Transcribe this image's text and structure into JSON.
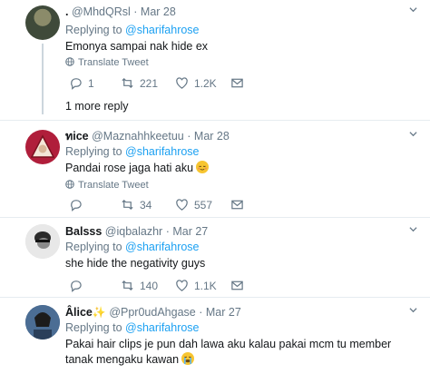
{
  "tweets": [
    {
      "display_name": ".",
      "handle": "@MhdQRsl",
      "time": "Mar 28",
      "reply_prefix": "Replying to",
      "reply_mention": "@sharifahrose",
      "text": "Emonya sampai nak hide ex",
      "translate": "Translate Tweet",
      "replies": "1",
      "retweets": "221",
      "likes": "1.2K",
      "more_replies": "1 more reply"
    },
    {
      "display_name": "ทice",
      "handle": "@Maznahhkeetuu",
      "time": "Mar 28",
      "reply_prefix": "Replying to",
      "reply_mention": "@sharifahrose",
      "text": "Pandai rose jaga hati aku",
      "emoji": "relieved-face",
      "translate": "Translate Tweet",
      "replies": "",
      "retweets": "34",
      "likes": "557"
    },
    {
      "display_name": "Balsss",
      "handle": "@iqbalazhr",
      "time": "Mar 27",
      "reply_prefix": "Replying to",
      "reply_mention": "@sharifahrose",
      "text": "she hide the negativity guys",
      "replies": "",
      "retweets": "140",
      "likes": "1.1K"
    },
    {
      "display_name": "Âlice",
      "name_emoji": "sparkles",
      "handle": "@Ppr0udAhgase",
      "time": "Mar 27",
      "reply_prefix": "Replying to",
      "reply_mention": "@sharifahrose",
      "text": "Pakai hair clips je pun dah lawa aku kalau pakai mcm tu member tanak mengaku kawan",
      "emoji": "loudly-crying-face"
    }
  ],
  "colors": {
    "accent": "#1da1f2",
    "muted": "#657786",
    "text": "#14171a",
    "divider": "#e6ecf0"
  },
  "icons": [
    "reply-icon",
    "retweet-icon",
    "like-icon",
    "dm-icon",
    "globe-icon",
    "chevron-down-icon"
  ]
}
